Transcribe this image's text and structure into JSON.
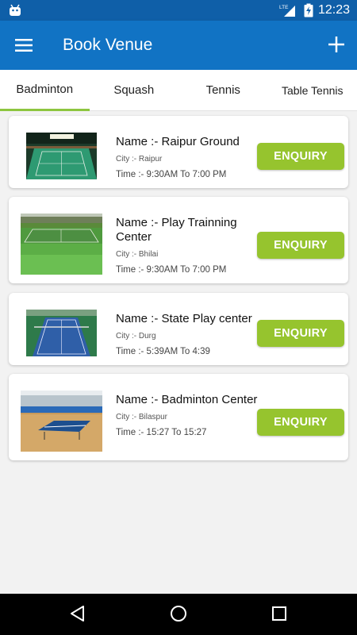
{
  "status_bar": {
    "time": "12:23",
    "network": "LTE",
    "left_icon": "android-icon",
    "right_icons": [
      "signal-icon",
      "battery-icon"
    ]
  },
  "app_bar": {
    "title": "Book Venue",
    "left_icon": "menu-icon",
    "right_icon": "add-icon",
    "color": "#1173c4"
  },
  "tabs": [
    {
      "label": "Badminton",
      "active": true
    },
    {
      "label": "Squash",
      "active": false
    },
    {
      "label": "Tennis",
      "active": false
    },
    {
      "label": "Table Tennis",
      "active": false
    }
  ],
  "venues": [
    {
      "name": "Name :- Raipur Ground",
      "city": "City :- Raipur",
      "time": "Time :- 9:30AM To 7:00 PM",
      "button": "ENQUIRY",
      "image": "indoor-badminton-court"
    },
    {
      "name": "Name :- Play Trainning Center",
      "city": "City :- Bhilai",
      "time": "Time :- 9:30AM To 7:00 PM",
      "button": "ENQUIRY",
      "image": "outdoor-grass-court"
    },
    {
      "name": "Name :- State Play center",
      "city": "City :- Durg",
      "time": "Time :- 5:39AM To 4:39",
      "button": "ENQUIRY",
      "image": "blue-tennis-court"
    },
    {
      "name": "Name :- Badminton Center",
      "city": "City :- Bilaspur",
      "time": "Time :- 15:27 To 15:27",
      "button": "ENQUIRY",
      "image": "table-tennis-hall"
    }
  ],
  "colors": {
    "primary": "#1173c4",
    "status_bar": "#0f5fa8",
    "accent": "#96c42e",
    "tab_indicator": "#8dc63f"
  },
  "nav_bar": {
    "icons": [
      "back-icon",
      "home-icon",
      "recents-icon"
    ]
  }
}
